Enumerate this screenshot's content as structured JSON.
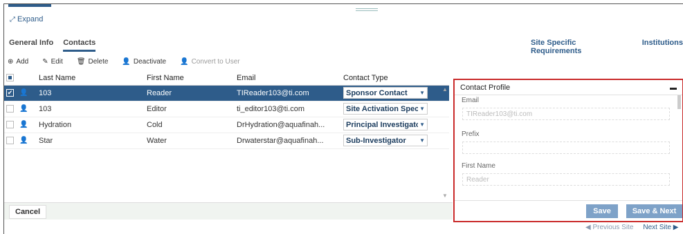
{
  "expand_label": "Expand",
  "tabs_left": [
    {
      "label": "General Info"
    },
    {
      "label": "Contacts"
    }
  ],
  "tabs_right": [
    {
      "label": "Site Specific Requirements"
    },
    {
      "label": "Institutions"
    }
  ],
  "toolbar": {
    "add": "Add",
    "edit": "Edit",
    "delete": "Delete",
    "deactivate": "Deactivate",
    "convert": "Convert to User"
  },
  "grid": {
    "columns": [
      "Last Name",
      "First Name",
      "Email",
      "Contact Type"
    ],
    "rows": [
      {
        "last": "103",
        "first": "Reader",
        "email": "TIReader103@ti.com",
        "type": "Sponsor Contact",
        "checked": true,
        "person_color": "#ffffff"
      },
      {
        "last": "103",
        "first": "Editor",
        "email": "ti_editor103@ti.com",
        "type": "Site Activation Specialist",
        "checked": false,
        "person_color": "#8cc63f"
      },
      {
        "last": "Hydration",
        "first": "Cold",
        "email": "DrHydration@aquafinah...",
        "type": "Principal Investigator",
        "checked": false,
        "person_color": "#666666"
      },
      {
        "last": "Star",
        "first": "Water",
        "email": "Drwaterstar@aquafinah...",
        "type": "Sub-Investigator",
        "checked": false,
        "person_color": "#666666"
      }
    ]
  },
  "cancel_label": "Cancel",
  "panel": {
    "title": "Contact Profile",
    "fields": [
      {
        "label": "Email",
        "value": "TIReader103@ti.com"
      },
      {
        "label": "Prefix",
        "value": ""
      },
      {
        "label": "First Name",
        "value": "Reader"
      }
    ],
    "save": "Save",
    "save_next": "Save & Next"
  },
  "site_nav": {
    "prev": "◀ Previous Site",
    "next": "Next Site ▶"
  },
  "colors": {
    "accent": "#2e5c8a",
    "highlight_border": "#c92a2a",
    "button": "#7ea2c8"
  }
}
